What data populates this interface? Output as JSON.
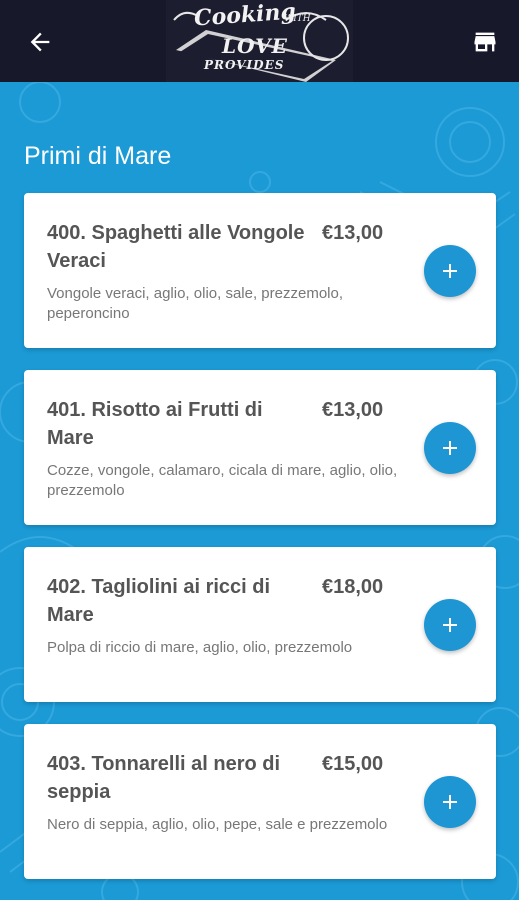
{
  "header": {
    "logo": {
      "line1": "Cooking",
      "line2": "WITH",
      "line3": "LOVE",
      "line4": "PROVIDES"
    },
    "back_icon": "arrow-back-icon",
    "store_icon": "storefront-icon"
  },
  "section": {
    "title": "Primi di Mare"
  },
  "items": [
    {
      "name": "400. Spaghetti alle Vongole Veraci",
      "price": "€13,00",
      "description": "Vongole veraci, aglio, olio, sale, prezzemolo, peperoncino"
    },
    {
      "name": "401. Risotto ai Frutti di Mare",
      "price": "€13,00",
      "description": "Cozze, vongole, calamaro, cicala di mare, aglio, olio, prezzemolo"
    },
    {
      "name": "402. Tagliolini ai ricci di Mare",
      "price": "€18,00",
      "description": "Polpa di riccio di mare, aglio, olio, prezzemolo"
    },
    {
      "name": "403. Tonnarelli al nero di seppia",
      "price": "€15,00",
      "description": "Nero di seppia, aglio, olio, pepe, sale e prezzemolo"
    }
  ],
  "colors": {
    "header_bg": "#17182a",
    "page_bg": "#1b9ad6",
    "accent": "#1e96d3",
    "text_dark": "#555555",
    "text_muted": "#777777"
  }
}
